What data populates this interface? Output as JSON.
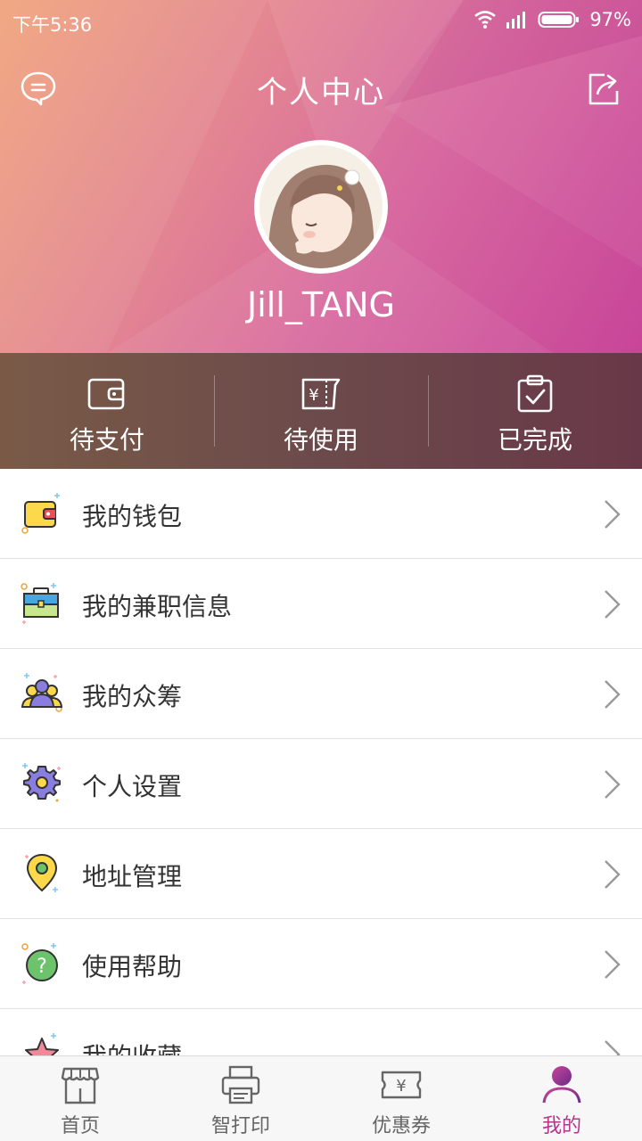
{
  "status_bar": {
    "time": "下午5:36",
    "battery": "97%"
  },
  "header": {
    "title": "个人中心",
    "username": "Jill_TANG",
    "icons": {
      "left": "message-icon",
      "right": "share-icon"
    }
  },
  "orders": [
    {
      "label": "待支付",
      "icon": "wallet-icon"
    },
    {
      "label": "待使用",
      "icon": "ticket-icon"
    },
    {
      "label": "已完成",
      "icon": "clipboard-check-icon"
    }
  ],
  "menu": [
    {
      "label": "我的钱包",
      "icon": "wallet-icon"
    },
    {
      "label": "我的兼职信息",
      "icon": "briefcase-icon"
    },
    {
      "label": "我的众筹",
      "icon": "group-icon"
    },
    {
      "label": "个人设置",
      "icon": "gear-icon"
    },
    {
      "label": "地址管理",
      "icon": "location-pin-icon"
    },
    {
      "label": "使用帮助",
      "icon": "help-icon"
    },
    {
      "label": "我的收藏",
      "icon": "star-icon"
    }
  ],
  "tabbar": [
    {
      "label": "首页",
      "icon": "store-icon",
      "active": false
    },
    {
      "label": "智打印",
      "icon": "printer-icon",
      "active": false
    },
    {
      "label": "优惠券",
      "icon": "coupon-icon",
      "active": false
    },
    {
      "label": "我的",
      "icon": "user-icon",
      "active": true
    }
  ],
  "colors": {
    "header_gradient": [
      "#f0a47c",
      "#c84598"
    ],
    "orders_bar": "#6c4a4b",
    "active_tab": "#b8338d"
  }
}
